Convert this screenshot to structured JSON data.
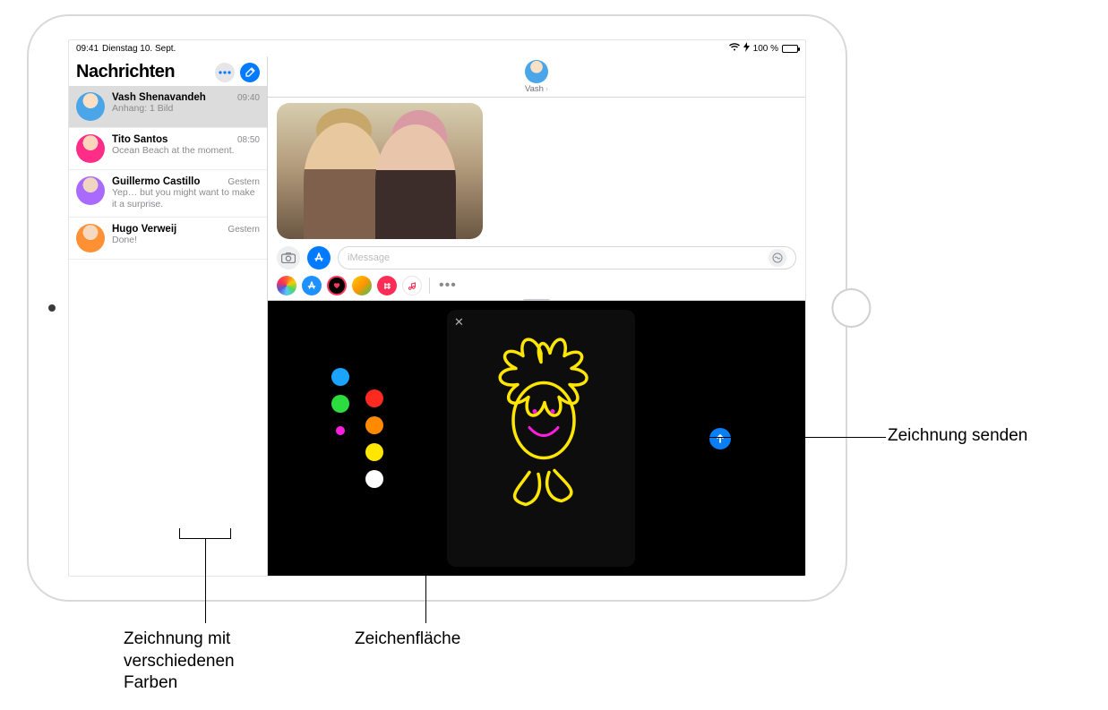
{
  "status": {
    "time": "09:41",
    "date": "Dienstag 10. Sept.",
    "battery": "100 %",
    "wifi_icon": "wifi",
    "lightning_icon": "charging"
  },
  "sidebar": {
    "title": "Nachrichten",
    "conversations": [
      {
        "name": "Vash Shenavandeh",
        "time": "09:40",
        "preview": "Anhang: 1 Bild",
        "avatar_bg": "#4aa6e8"
      },
      {
        "name": "Tito Santos",
        "time": "08:50",
        "preview": "Ocean Beach at the moment.",
        "avatar_bg": "#ff2d87"
      },
      {
        "name": "Guillermo Castillo",
        "time": "Gestern",
        "preview": "Yep… but you might want to make it a surprise.",
        "avatar_bg": "#a96bff"
      },
      {
        "name": "Hugo Verweij",
        "time": "Gestern",
        "preview": "Done!",
        "avatar_bg": "#ff9134"
      }
    ]
  },
  "chat": {
    "contact_name": "Vash",
    "input_placeholder": "iMessage"
  },
  "digital_touch": {
    "colors_left": [
      "#1aa4ff",
      "#2ddc3f",
      "#ff1ee0"
    ],
    "colors_right": [
      "#ff2a1f",
      "#ff8a00",
      "#ffe600",
      "#ffffff"
    ],
    "selected_color": "#ff1ee0",
    "drawing_stroke": "#ffe600",
    "face_stroke": "#ff1ee0"
  },
  "callouts": {
    "send": "Zeichnung senden",
    "canvas": "Zeichenfläche",
    "palette": "Zeichnung mit verschiedenen Farben"
  }
}
